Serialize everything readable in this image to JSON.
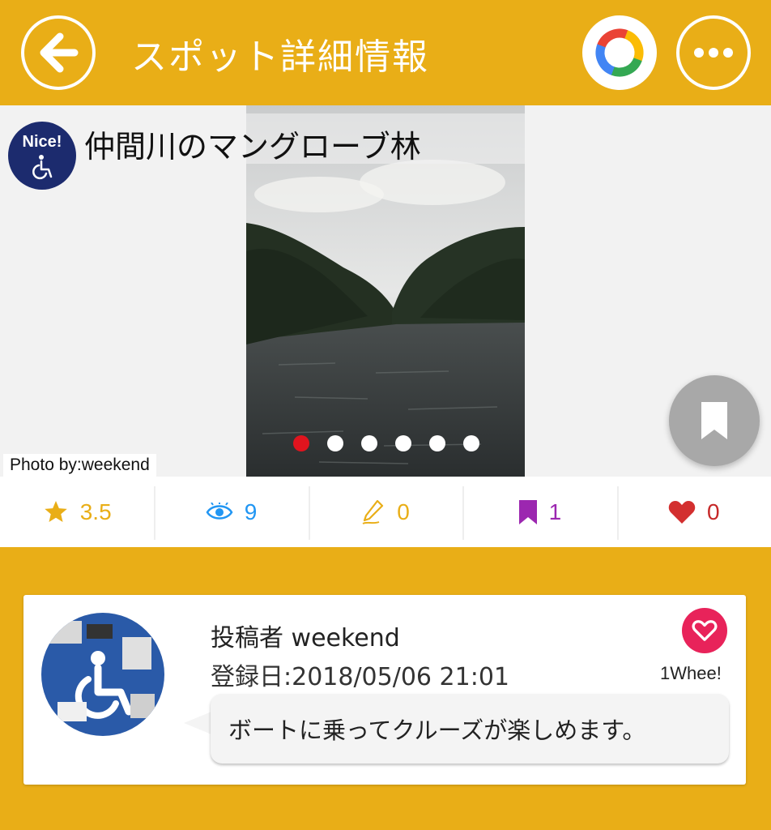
{
  "header": {
    "title": "スポット詳細情報",
    "accent_color": "#e9ae17",
    "back_icon": "arrow-left-icon",
    "google_icon": "google-ring-icon",
    "more_icon": "more-dots-icon"
  },
  "spot": {
    "badge_text": "Nice!",
    "badge_icon": "wheelchair-icon",
    "name": "仲間川のマングローブ林",
    "photo_credit": "Photo by:weekend",
    "carousel": {
      "total": 6,
      "active_index": 0,
      "active_color": "#e0141e"
    },
    "bookmark_icon": "bookmark-icon"
  },
  "stats": [
    {
      "icon": "star-icon",
      "value": "3.5",
      "color": "#e9ae17"
    },
    {
      "icon": "eye-icon",
      "value": "9",
      "color": "#2196f3"
    },
    {
      "icon": "pencil-icon",
      "value": "0",
      "color": "#e9ae17"
    },
    {
      "icon": "bookmark-icon",
      "value": "1",
      "color": "#9c27b0"
    },
    {
      "icon": "heart-icon",
      "value": "0",
      "color": "#c62828"
    }
  ],
  "post": {
    "poster_label": "投稿者 weekend",
    "registered": "登録日:2018/05/06 21:01",
    "whee_count": "1Whee!",
    "comment": "ボートに乗ってクルーズが楽しめます。",
    "avatar_icon": "wheelchair-sign-avatar"
  }
}
